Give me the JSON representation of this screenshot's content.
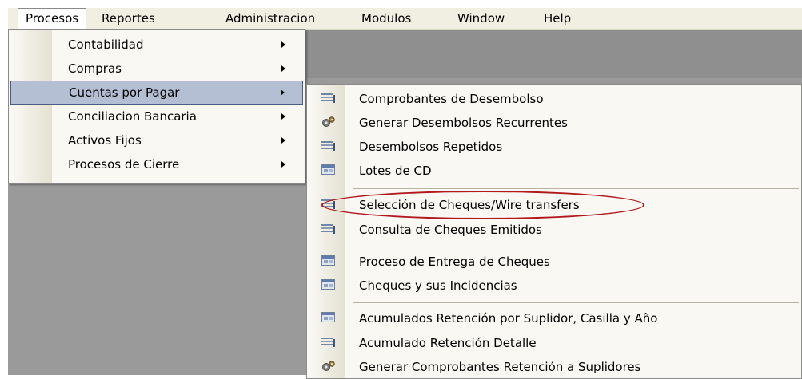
{
  "menubar": {
    "items": [
      {
        "label": "Procesos"
      },
      {
        "label": "Reportes"
      },
      {
        "label": "Administracion"
      },
      {
        "label": "Modulos"
      },
      {
        "label": "Window"
      },
      {
        "label": "Help"
      }
    ]
  },
  "procesos_menu": {
    "items": [
      {
        "label": "Contabilidad"
      },
      {
        "label": "Compras"
      },
      {
        "label": "Cuentas por Pagar"
      },
      {
        "label": "Conciliacion Bancaria"
      },
      {
        "label": "Activos Fijos"
      },
      {
        "label": "Procesos de Cierre"
      }
    ]
  },
  "cxp_menu": {
    "items": [
      {
        "label": "Comprobantes de Desembolso",
        "icon": "list-icon"
      },
      {
        "label": "Generar Desembolsos Recurrentes",
        "icon": "gears-icon"
      },
      {
        "label": "Desembolsos Repetidos",
        "icon": "list-icon"
      },
      {
        "label": "Lotes de CD",
        "icon": "window-icon"
      },
      {
        "label": "Selección de Cheques/Wire transfers",
        "icon": "list-icon"
      },
      {
        "label": "Consulta de Cheques Emitidos",
        "icon": "list-icon"
      },
      {
        "label": "Proceso de Entrega de Cheques",
        "icon": "window-icon"
      },
      {
        "label": "Cheques y sus Incidencias",
        "icon": "window-icon"
      },
      {
        "label": "Acumulados Retención por Suplidor, Casilla y Año",
        "icon": "window-icon"
      },
      {
        "label": "Acumulado Retención Detalle",
        "icon": "list-icon"
      },
      {
        "label": "Generar Comprobantes Retención a Suplidores",
        "icon": "gears-icon"
      }
    ]
  },
  "colors": {
    "highlight": "#b4bfd4",
    "highlight_border": "#4a5c82",
    "annotation": "#b0181d",
    "menubar": "#f1efe2"
  }
}
